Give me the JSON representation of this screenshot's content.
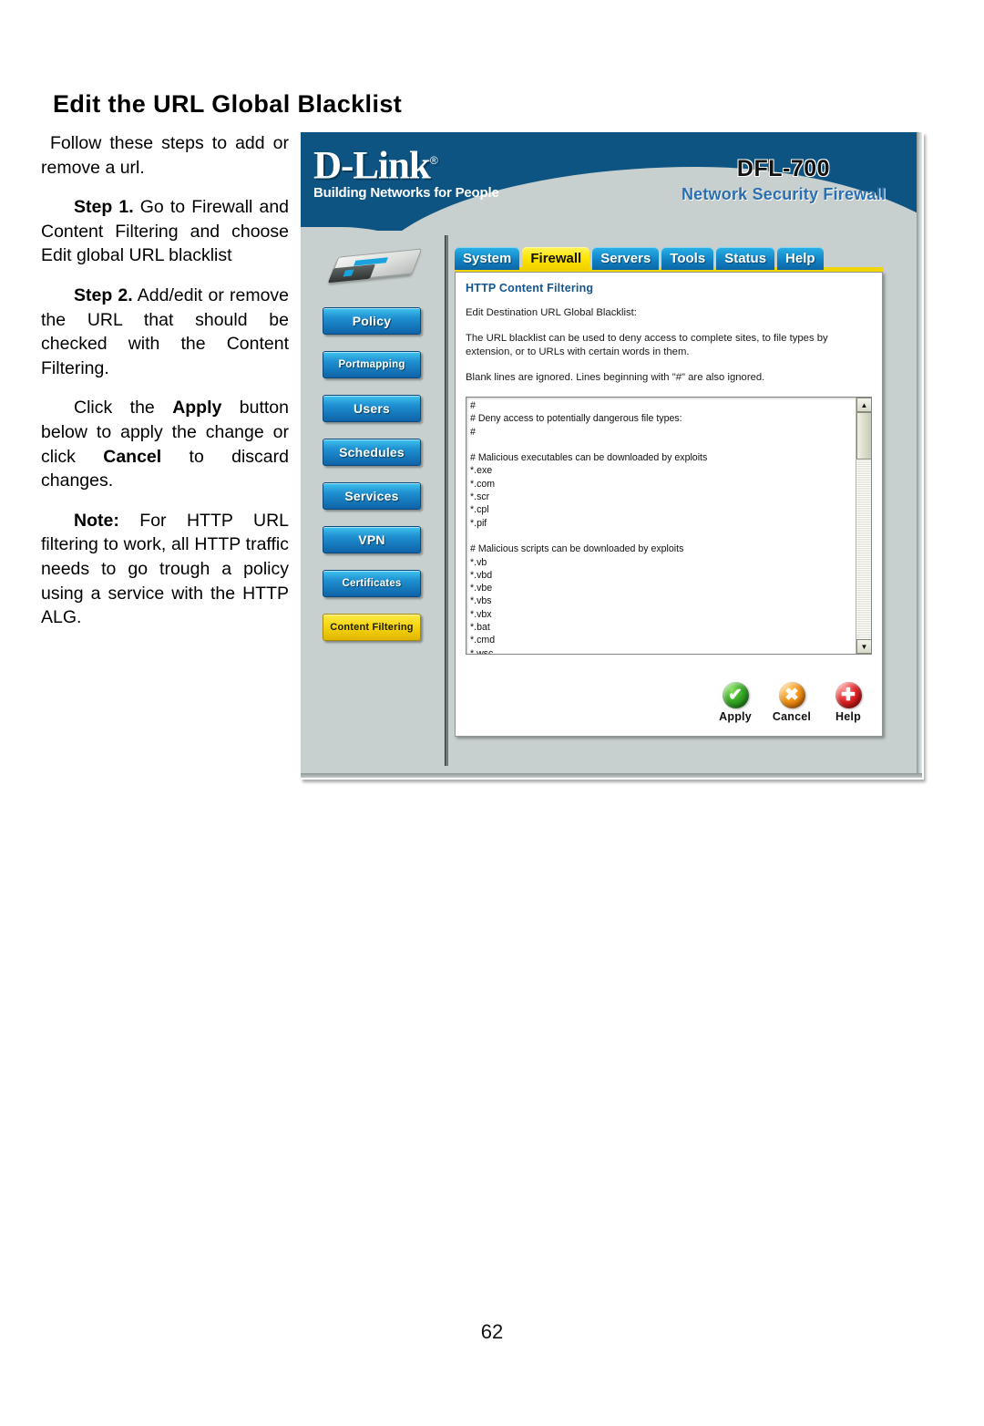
{
  "document": {
    "heading": "Edit the URL Global Blacklist",
    "page_number": "62",
    "paragraphs": {
      "lead": "Follow these steps to add or remove a url.",
      "step1_label": "Step 1.",
      "step1_text": " Go to Firewall and Content Filtering and choose Edit global URL blacklist",
      "step2_label": "Step 2.",
      "step2_text": " Add/edit or remove the URL that should be checked with the Content Filtering.",
      "click_pre": "Click the ",
      "click_apply": "Apply",
      "click_mid": " button below to apply the change or click ",
      "click_cancel": "Cancel",
      "click_post": " to discard changes.",
      "note_label": "Note:",
      "note_text": " For HTTP URL filtering to work, all HTTP traffic needs to go trough a policy using a service with the HTTP ALG."
    }
  },
  "screenshot": {
    "banner": {
      "logo": "D-Link",
      "logo_registered": "®",
      "tagline": "Building Networks for People",
      "model": "DFL-700",
      "model_subtitle": "Network Security Firewall"
    },
    "tabs": [
      {
        "label": "System",
        "active": false
      },
      {
        "label": "Firewall",
        "active": true
      },
      {
        "label": "Servers",
        "active": false
      },
      {
        "label": "Tools",
        "active": false
      },
      {
        "label": "Status",
        "active": false
      },
      {
        "label": "Help",
        "active": false
      }
    ],
    "sidebar": [
      {
        "label": "Policy",
        "active": false,
        "small": false
      },
      {
        "label": "Portmapping",
        "active": false,
        "small": true
      },
      {
        "label": "Users",
        "active": false,
        "small": false
      },
      {
        "label": "Schedules",
        "active": false,
        "small": false
      },
      {
        "label": "Services",
        "active": false,
        "small": false
      },
      {
        "label": "VPN",
        "active": false,
        "small": false
      },
      {
        "label": "Certificates",
        "active": false,
        "small": true
      },
      {
        "label": "Content Filtering",
        "active": true,
        "small": true
      }
    ],
    "panel": {
      "title": "HTTP Content Filtering",
      "subtitle": "Edit Destination URL Global Blacklist:",
      "description": "The URL blacklist can be used to deny access to complete sites, to file types by extension, or to URLs with certain words in them.",
      "hint": "Blank lines are ignored. Lines beginning with \"#\" are also ignored.",
      "blacklist_text": "#\n# Deny access to potentially dangerous file types:\n#\n\n# Malicious executables can be downloaded by exploits\n*.exe\n*.com\n*.scr\n*.cpl\n*.pif\n\n# Malicious scripts can be downloaded by exploits\n*.vb\n*.vbd\n*.vbe\n*.vbs\n*.vbx\n*.bat\n*.cmd\n*.wsc\n*.wsf\n*.wsh\n*.sct\n\n# Shell scraps can contain executables and invoke nearly any command",
      "scrollbar": {
        "up_arrow": "▲",
        "down_arrow": "▼"
      }
    },
    "actions": [
      {
        "label": "Apply",
        "glyph": "✔",
        "color": "#35a823"
      },
      {
        "label": "Cancel",
        "glyph": "✖",
        "color": "#f39314"
      },
      {
        "label": "Help",
        "glyph": "✚",
        "color": "#e02424"
      }
    ]
  }
}
